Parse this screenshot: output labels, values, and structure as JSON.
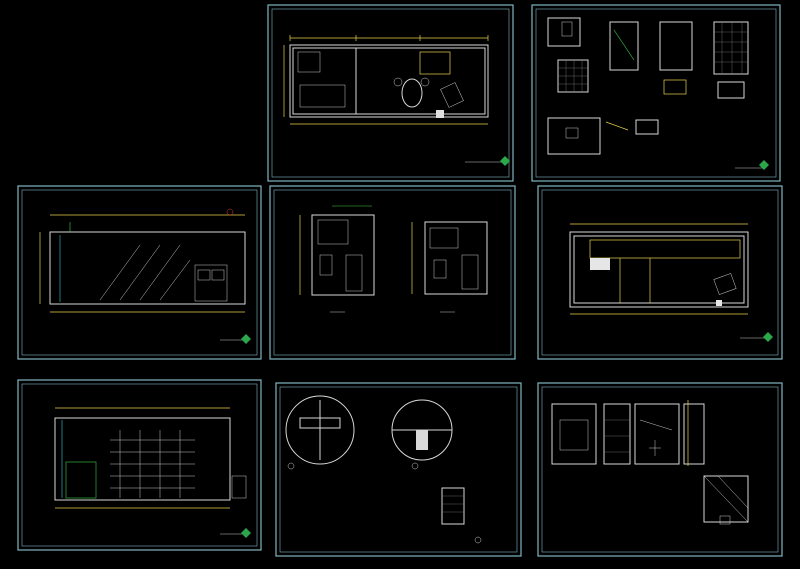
{
  "sheets": [
    {
      "id": "plan-top",
      "title": "",
      "dims": []
    },
    {
      "id": "details-top-right",
      "title": "",
      "dims": []
    },
    {
      "id": "elevation-left",
      "title": "",
      "dims": []
    },
    {
      "id": "section-mid",
      "title": "",
      "dims": []
    },
    {
      "id": "plan-right",
      "title": "",
      "dims": []
    },
    {
      "id": "elevation-bottom-left",
      "title": "",
      "dims": []
    },
    {
      "id": "node-details",
      "title": "",
      "dims": []
    },
    {
      "id": "details-bottom-right",
      "title": "",
      "dims": []
    }
  ],
  "colors": {
    "background": "#000000",
    "frame": "#7fb6c2",
    "wall": "#d8d8d8",
    "dimension": "#e8d24a",
    "annotation": "#3fd04a",
    "glass": "#31c6d4"
  },
  "icons": [
    "title-block-diamond-icon"
  ]
}
